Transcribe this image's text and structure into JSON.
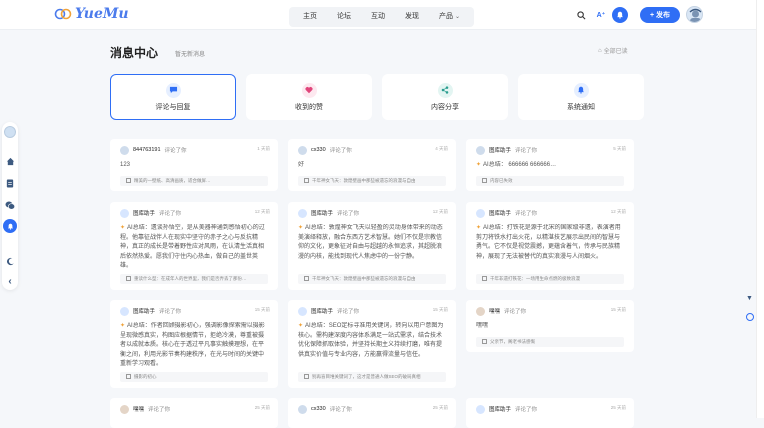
{
  "header": {
    "logo_text": "YueMu",
    "nav": [
      {
        "label": "主页"
      },
      {
        "label": "论坛"
      },
      {
        "label": "互动"
      },
      {
        "label": "发现"
      },
      {
        "label": "产品"
      }
    ],
    "publish_label": "发布",
    "publish_icon": "+"
  },
  "page": {
    "title": "消息中心",
    "subtitle": "暂无新消息",
    "read_all": "全部已读"
  },
  "tabs": [
    {
      "label": "评论与回复",
      "icon": "chat-icon",
      "color": "#2f6ef5",
      "bg": "#e6efff",
      "active": true
    },
    {
      "label": "收到的赞",
      "icon": "heart-icon",
      "color": "#e0457b",
      "bg": "#fde8ef",
      "active": false
    },
    {
      "label": "内容分享",
      "icon": "share-icon",
      "color": "#2a9d8f",
      "bg": "#e3f5f2",
      "active": false
    },
    {
      "label": "系统通知",
      "icon": "bell-icon",
      "color": "#2f6ef5",
      "bg": "#e6efff",
      "active": false
    }
  ],
  "cards": [
    {
      "user": "844763191",
      "action": "评论了你",
      "time": "1 天前",
      "text": "123",
      "quote": "精美的一壁纸、高清画质，适合做屏…"
    },
    {
      "user": "cx330",
      "action": "评论了你",
      "time": "4 天前",
      "text": "好",
      "quote": "千年神女飞天：敦煌壁画中那些被遗忘的浪漫与自由"
    },
    {
      "user": "图库助手",
      "action": "评论了你",
      "time": "5 天前",
      "text": "AI总结： 666666 666666…",
      "quote": "内容已失效"
    },
    {
      "user": "图库助手",
      "action": "评论了你",
      "time": "12 天前",
      "text": "AI总结：遗谈孙悟空，是从美器神通到感悟初心的过程。他靠征战伴人在现实中坚守的赤子之心与反抗精神，真正的成长是带着野性应对风雨，在认清生活真相后依然热爱。愿我们守住内心热血，做自己的盖世英雄。",
      "quote": "重读什么型：在成年人的世界里，我们是否弄丢了那份…"
    },
    {
      "user": "图库助手",
      "action": "评论了你",
      "time": "12 天前",
      "text": "AI总结：敦煌神女飞天以轻盈的灵动身体带来的动态美演绎释放，融合东西方艺术智慧。她们不仅是宗教信仰的文化，更象征对自由与超越的永恒追求，其超脱浪漫的内核，能找到现代人焦虑中的一份宁静。",
      "quote": "千年神女飞天：敦煌壁画中那些被遗忘的浪漫与自由"
    },
    {
      "user": "图库助手",
      "action": "评论了你",
      "time": "12 天前",
      "text": "AI总结：打铁花是源于北宋的国家级非遗，表演者用剪刀将铁水打出火花，以精湛技艺展示出民间的智慧与勇气。它不仅是视觉震撼，更蕴含着气，传承与民族精神，展现了无法被替代的真实浪漫与人间烟火。",
      "quote": "千年非遗打铁花：一场用生命点燃的极致浪漫"
    },
    {
      "user": "图库助手",
      "action": "评论了你",
      "time": "15 天前",
      "text": "AI总结：作者回顾摄影初心，强调影像探索需以摄影呈现微感真实，构图应根据情节，拒绝冷漠，尊重被摄者以成就本质。核心在于透过平凡事实触摸理想，在平衡之间，利用光影节奏构建秩序，在光与时间的关键中重新学习观看。",
      "quote": "摄影的初心"
    },
    {
      "user": "图库助手",
      "action": "评论了你",
      "time": "15 天前",
      "text": "AI总结：SEO定标寻准用关键词，转向以用户意图为核心。需构建深度内容体系满足一站式需求，结合技术优化保障抓取体验，并坚持长期主义持续打磨，唯有提供真实价值与专业内容，方能赢得流量与信任。",
      "quote": "别再盲目堆关键词了，这才是普通人做SEO的破局真相"
    },
    {
      "user": "嘿嘿",
      "action": "评论了你",
      "time": "15 天前",
      "text": "嘿嘿",
      "quote": "父亲节，阁老书法感慨"
    },
    {
      "user": "嘿嘿",
      "action": "评论了你",
      "time": "25 天前",
      "text": "",
      "quote": ""
    },
    {
      "user": "cx330",
      "action": "评论了你",
      "time": "25 天前",
      "text": "",
      "quote": ""
    },
    {
      "user": "图库助手",
      "action": "评论了你",
      "time": "25 天前",
      "text": "",
      "quote": ""
    }
  ],
  "colors": {
    "accent": "#2f6ef5",
    "brand": "#4b7bec"
  }
}
